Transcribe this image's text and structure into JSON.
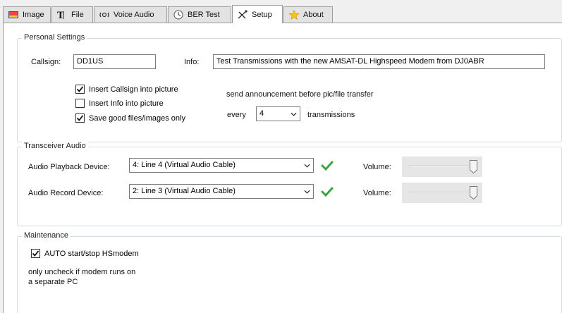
{
  "tabs": [
    {
      "label": "Image",
      "icon": "image-icon"
    },
    {
      "label": "File",
      "icon": "file-icon"
    },
    {
      "label": "Voice Audio",
      "icon": "voice-audio-icon"
    },
    {
      "label": "BER Test",
      "icon": "ber-test-icon"
    },
    {
      "label": "Setup",
      "icon": "setup-icon",
      "active": true
    },
    {
      "label": "About",
      "icon": "star-icon"
    }
  ],
  "personal": {
    "title": "Personal Settings",
    "callsign_label": "Callsign:",
    "callsign_value": "DD1US",
    "info_label": "Info:",
    "info_value": "Test Transmissions with the new AMSAT-DL Highspeed Modem from DJ0ABR",
    "checkboxes": [
      {
        "label": "Insert Callsign into picture",
        "checked": true
      },
      {
        "label": "Insert Info into picture",
        "checked": false
      },
      {
        "label": "Save good files/images only",
        "checked": true
      }
    ],
    "announce_label": "send announcement before pic/file transfer",
    "every_label": "every",
    "every_value": "4",
    "transmissions_label": "transmissions"
  },
  "audio": {
    "title": "Transceiver Audio",
    "playback_label": "Audio Playback Device:",
    "playback_value": "4: Line 4 (Virtual Audio Cable)",
    "record_label": "Audio Record Device:",
    "record_value": "2: Line 3 (Virtual Audio Cable)",
    "volume_label": "Volume:",
    "playback_volume": 0.95,
    "record_volume": 0.95,
    "ok_color": "#3aa53a"
  },
  "maintenance": {
    "title": "Maintenance",
    "auto_label": "AUTO start/stop HSmodem",
    "auto_checked": true,
    "note_line1": "only uncheck if modem runs on",
    "note_line2": "a separate PC"
  }
}
